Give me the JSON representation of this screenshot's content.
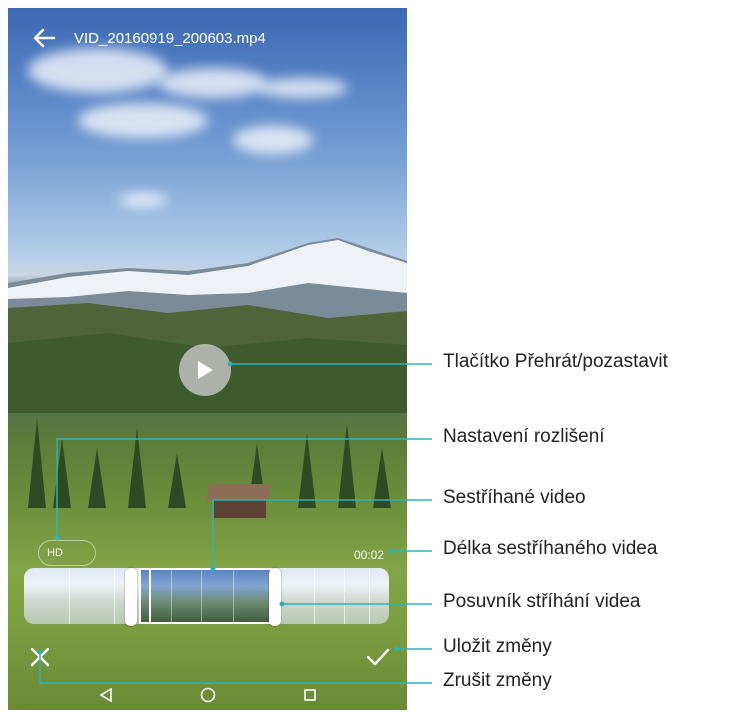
{
  "header": {
    "title": "VID_20160919_200603.mp4"
  },
  "player": {
    "resolution_label": "HD",
    "trimmed_duration": "00:02"
  },
  "callouts": {
    "play_pause": "Tlačítko Přehrát/pozastavit",
    "resolution": "Nastavení rozlišení",
    "trimmed_video": "Sestříhané video",
    "trimmed_length": "Délka sestříhaného videa",
    "trim_slider": "Posuvník stříhání videa",
    "save": "Uložit změny",
    "cancel": "Zrušit změny"
  },
  "icons": {
    "back": "back-arrow-icon",
    "play": "play-icon",
    "cancel": "close-icon",
    "save": "check-icon",
    "nav_back": "triangle-back-icon",
    "nav_home": "circle-home-icon",
    "nav_recent": "square-recent-icon"
  },
  "colors": {
    "callout_line": "#2fb2b6",
    "label_text": "#222222"
  }
}
